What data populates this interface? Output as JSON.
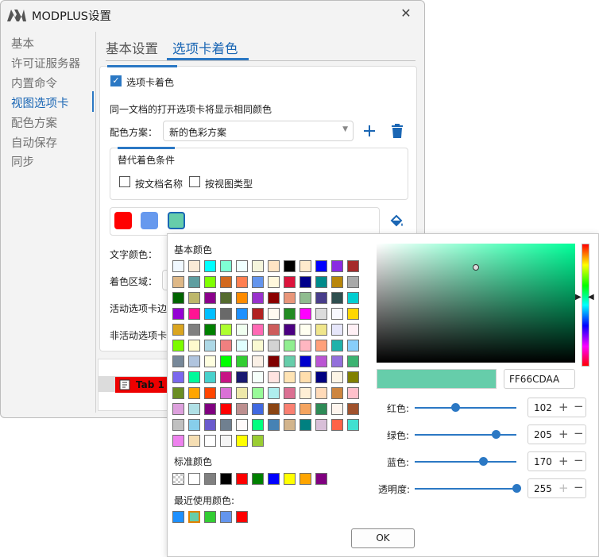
{
  "window": {
    "title": "MODPLUS设置",
    "close_symbol": "✕"
  },
  "sidebar": {
    "items": [
      {
        "label": "基本"
      },
      {
        "label": "许可证服务器"
      },
      {
        "label": "内置命令"
      },
      {
        "label": "视图选项卡",
        "active": true
      },
      {
        "label": "配色方案"
      },
      {
        "label": "自动保存"
      },
      {
        "label": "同步"
      }
    ]
  },
  "tabs": [
    {
      "label": "基本设置"
    },
    {
      "label": "选项卡着色",
      "active": true
    }
  ],
  "settings": {
    "enable_label": "选项卡着色",
    "enable_checked": true,
    "description": "同一文档的打开选项卡将显示相同颜色",
    "scheme_label": "配色方案：",
    "scheme_value": "新的色彩方案",
    "add_icon": "plus-icon",
    "delete_icon": "trash-icon",
    "alt_title": "替代着色条件",
    "by_doc_label": "按文档名称",
    "by_view_label": "按视图类型",
    "swatches": [
      "#ff0000",
      "#6699ee",
      "#66cdaa"
    ],
    "fill_icon": "paint-bucket-icon",
    "text_color_label": "文字颜色：",
    "area_label": "着色区域：",
    "active_tab_label": "活动选项卡边",
    "inactive_tab_label": "非活动选项卡",
    "preview_tab_label": "Tab 1"
  },
  "color_dialog": {
    "basic_colors_label": "基本颜色",
    "basic_colors": [
      "#f0f8ff",
      "#faebd7",
      "#00ffff",
      "#7fffd4",
      "#f0ffff",
      "#f5f5dc",
      "#ffe4c4",
      "#000000",
      "#ffebcd",
      "#0000ff",
      "#8a2be2",
      "#a52a2a",
      "#deb887",
      "#5f9ea0",
      "#7fff00",
      "#d2691e",
      "#ff7f50",
      "#6495ed",
      "#fff8dc",
      "#dc143c",
      "#00008b",
      "#008b8b",
      "#b8860b",
      "#a9a9a9",
      "#006400",
      "#bdb76b",
      "#8b008b",
      "#556b2f",
      "#ff8c00",
      "#9932cc",
      "#8b0000",
      "#e9967a",
      "#8fbc8f",
      "#483d8b",
      "#2f4f4f",
      "#00ced1",
      "#9400d3",
      "#ff1493",
      "#00bfff",
      "#696969",
      "#1e90ff",
      "#b22222",
      "#fffaf0",
      "#228b22",
      "#ff00ff",
      "#dcdcdc",
      "#f8f8ff",
      "#ffd700",
      "#daa520",
      "#808080",
      "#008000",
      "#adff2f",
      "#f0fff0",
      "#ff69b4",
      "#cd5c5c",
      "#4b0082",
      "#fffff0",
      "#f0e68c",
      "#e6e6fa",
      "#fff0f5",
      "#7cfc00",
      "#fffacd",
      "#add8e6",
      "#f08080",
      "#e0ffff",
      "#fafad2",
      "#d3d3d3",
      "#90ee90",
      "#ffb6c1",
      "#ffa07a",
      "#20b2aa",
      "#87cefa",
      "#778899",
      "#b0c4de",
      "#ffffe0",
      "#00ff00",
      "#32cd32",
      "#faf0e6",
      "#800000",
      "#66cdaa",
      "#0000cd",
      "#ba55d3",
      "#9370db",
      "#3cb371",
      "#7b68ee",
      "#00fa9a",
      "#48d1cc",
      "#c71585",
      "#191970",
      "#f5fffa",
      "#ffe4e1",
      "#ffe4b5",
      "#ffdead",
      "#000080",
      "#fdf5e6",
      "#808000",
      "#6b8e23",
      "#ffa500",
      "#ff4500",
      "#da70d6",
      "#eee8aa",
      "#98fb98",
      "#afeeee",
      "#db7093",
      "#ffefd5",
      "#ffdab9",
      "#cd853f",
      "#ffc0cb",
      "#dda0dd",
      "#b0e0e6",
      "#800080",
      "#ff0000",
      "#bc8f8f",
      "#4169e1",
      "#8b4513",
      "#fa8072",
      "#f4a460",
      "#2e8b57",
      "#fff5ee",
      "#a0522d",
      "#c0c0c0",
      "#87ceeb",
      "#6a5acd",
      "#708090",
      "#fffafa",
      "#00ff7f",
      "#4682b4",
      "#d2b48c",
      "#008080",
      "#d8bfd8",
      "#ff6347",
      "#40e0d0",
      "#ee82ee",
      "#f5deb3",
      "#ffffff",
      "#f5f5f5",
      "#ffff00",
      "#9acd32"
    ],
    "standard_colors_label": "标准颜色",
    "standard_colors": [
      "transparent",
      "#ffffff",
      "#808080",
      "#000000",
      "#ff0000",
      "#008000",
      "#0000ff",
      "#ffff00",
      "#ffa500",
      "#800080"
    ],
    "recent_colors_label": "最近使用颜色:",
    "recent_colors": [
      "#1e90ff",
      "#66cdaa",
      "#32cd32",
      "#6495ed",
      "#ff0000"
    ],
    "picker": {
      "saturation": 0.5,
      "value": 0.8,
      "hue_fraction": 0.44
    },
    "preview_color": "#66cdaa",
    "hex_value": "FF66CDAA",
    "channels": [
      {
        "label": "红色:",
        "value": "102",
        "fraction": 0.4
      },
      {
        "label": "绿色:",
        "value": "205",
        "fraction": 0.8
      },
      {
        "label": "蓝色:",
        "value": "170",
        "fraction": 0.67
      },
      {
        "label": "透明度:",
        "value": "255",
        "fraction": 1.0
      }
    ],
    "ok_label": "OK"
  }
}
